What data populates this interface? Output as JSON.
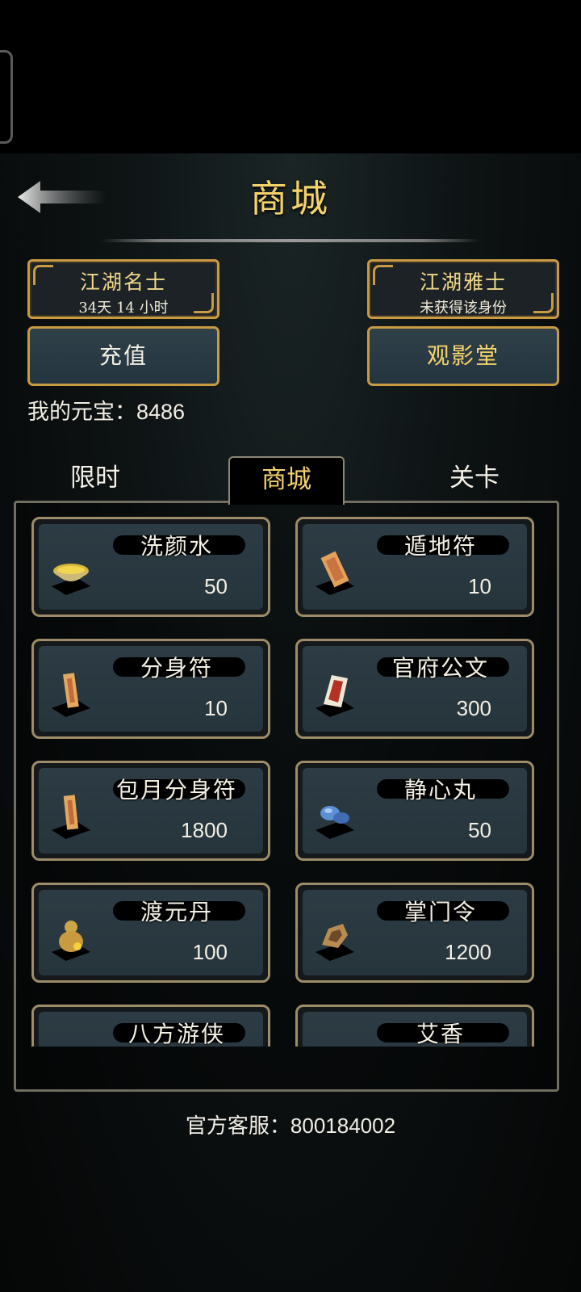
{
  "header": {
    "title": "商城"
  },
  "ranks": [
    {
      "name": "江湖名士",
      "sub": "34天 14 小时"
    },
    {
      "name": "江湖雅士",
      "sub": "未获得该身份"
    }
  ],
  "buttons": {
    "recharge": "充值",
    "theater": "观影堂"
  },
  "coins": {
    "label": "我的元宝：",
    "value": "8486"
  },
  "tabs": [
    {
      "label": "限时",
      "active": false
    },
    {
      "label": "商城",
      "active": true
    },
    {
      "label": "关卡",
      "active": false
    }
  ],
  "items": [
    {
      "name": "洗颜水",
      "price": "50",
      "icon": "bowl-icon"
    },
    {
      "name": "遁地符",
      "price": "10",
      "icon": "talisman-icon"
    },
    {
      "name": "分身符",
      "price": "10",
      "icon": "talisman-icon"
    },
    {
      "name": "官府公文",
      "price": "300",
      "icon": "document-icon"
    },
    {
      "name": "包月分身符",
      "price": "1800",
      "icon": "talisman-icon"
    },
    {
      "name": "静心丸",
      "price": "50",
      "icon": "pill-icon"
    },
    {
      "name": "渡元丹",
      "price": "100",
      "icon": "gourd-icon"
    },
    {
      "name": "掌门令",
      "price": "1200",
      "icon": "token-icon"
    },
    {
      "name": "八方游侠",
      "price": "",
      "icon": "figure-icon"
    },
    {
      "name": "艾香",
      "price": "",
      "icon": "incense-icon"
    }
  ],
  "footer": {
    "support": "官方客服：800184002"
  },
  "colors": {
    "gold": "#f5d36a",
    "border": "#c89b43",
    "button_bg": "#2f4049"
  }
}
